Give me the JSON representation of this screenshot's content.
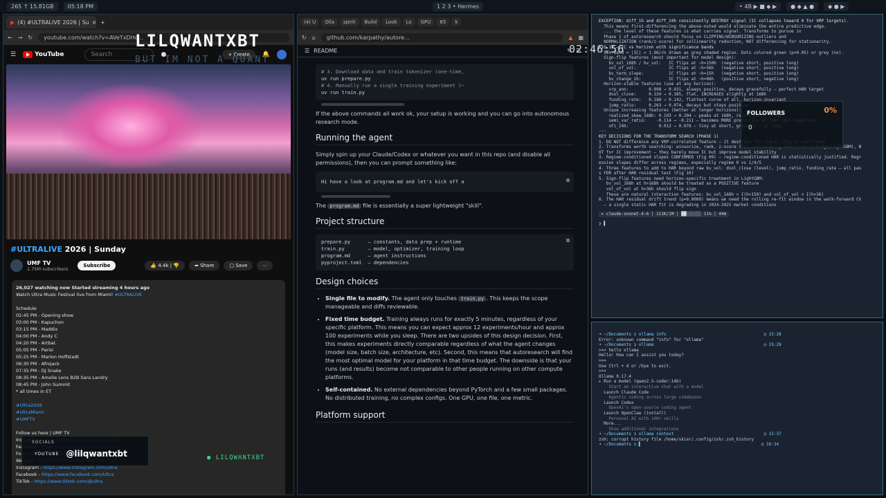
{
  "topbar": {
    "chip1": "265  ↑ 15.81GB",
    "chip2": "05:18 PM",
    "workspaces": "1  2  3  • Hermes",
    "right1": "• 4B ▶ ■ ◆ ▶",
    "right2": "● ◆ ▲ ●",
    "right3": "◆ ● ▶"
  },
  "youtube": {
    "tab_label": "(4) #ULTRALIVE 2026 | Su",
    "url": "youtube.com/watch?v=AVeTxDHo...",
    "logo": "YouTube",
    "search_placeholder": "Search",
    "create_label": "+ Create",
    "video_title_tag": "#ULTRALIVE",
    "video_title_rest": " 2026 | Sunday",
    "channel": "UMF TV",
    "subscribers": "1.75M subscribers",
    "subscribe_label": "Subscribe",
    "likes": "4.4k",
    "share_label": "Share",
    "save_label": "Save",
    "desc_stats": "26,027 watching now  Started streaming 4 hours ago",
    "desc_line": "Watch Ultra Music Festival live from Miami!",
    "desc_tag": "#ULTRALIVE",
    "schedule_header": "Schedule",
    "schedule": [
      "02:45 PM - Opening show",
      "03:00 PM - Kapuchon",
      "03:15 PM - Maddix",
      "04:00 PM - Andy C",
      "04:20 PM - Artbat",
      "05:05 PM - Parisi",
      "05:25 PM - Marlon Hoffstadt",
      "06:30 PM - Afrojack",
      "07:35 PM - DJ Snake",
      "08:35 PM - Amelie Lens B2B Sara Landry",
      "08:45 PM - John Summit",
      "* all times in ET"
    ],
    "hashtags": [
      "#Ultra2026",
      "#UltraMiami",
      "#UMFTV"
    ],
    "follow_header": "Follow us here | UMF TV",
    "links": [
      {
        "label": "Instagram - ",
        "url": "https://www.instagram.com/umftv"
      },
      {
        "label": "Facebook - ",
        "url": "https://www.facebook.com/umftv"
      },
      {
        "label": "Follow us here | Ultra Music Festival",
        "url": ""
      },
      {
        "label": "Website - ",
        "url": "https://ultramusicfestival.com"
      },
      {
        "label": "Instagram - ",
        "url": "https://www.instagram.com/ultra"
      },
      {
        "label": "Facebook - ",
        "url": "https://www.facebook.com/Ultra"
      },
      {
        "label": "TikTok - ",
        "url": "https://www.tiktok.com/@ultra"
      }
    ]
  },
  "overlay": {
    "name": "LILQWANTXBT",
    "sub": "BUT IM NOT A QUANT",
    "socials_header": "SOCIALS",
    "socials_platform": "YOUTUBE",
    "socials_handle": "@lilqwantxbt",
    "green_tag": "● LILQWANTXBT",
    "timer": "02:46:56",
    "followers_label": "FOLLOWERS",
    "followers_pct": "0%",
    "followers_count": "0"
  },
  "github": {
    "tabs": [
      "(4) U",
      "Olla",
      "spirit",
      "Build",
      "Look",
      "Lo",
      "GPU",
      "65",
      "k"
    ],
    "url": "github.com/karpathy/autore...",
    "readme_label": "README",
    "code1": [
      "# 3. Download data and train tokenizer (one-time,",
      "uv run prepare.py",
      "",
      "# 4. Manually run a single training experiment (~",
      "uv run train.py"
    ],
    "p1": "If the above commands all work ok, your setup is working and you can go into autonomous research mode.",
    "h_running": "Running the agent",
    "p2": "Simply spin up your Claude/Codex or whatever you want in this repo (and disable all permissions), then you can prompt something like:",
    "code2": "Hi have a look at program.md and let's kick off a",
    "p3_code": "program.md",
    "p3_rest": " file is essentially a super lightweight \"skill\".",
    "p3_pre": "The ",
    "h_structure": "Project structure",
    "code3": [
      "prepare.py      — constants, data prep + runtime",
      "train.py        — model, optimizer, training loop",
      "program.md      — agent instructions",
      "pyproject.toml  — dependencies"
    ],
    "h_design": "Design choices",
    "b1_title": "Single file to modify.",
    "b1_text": " The agent only touches ",
    "b1_code": "train.py",
    "b1_text2": ". This keeps the scope manageable and diffs reviewable.",
    "b2_title": "Fixed time budget.",
    "b2_text": " Training always runs for exactly 5 minutes, regardless of your specific platform. This means you can expect approx 12 experiments/hour and approx 100 experiments while you sleep. There are two upsides of this design decision. First, this makes experiments directly comparable regardless of what the agent changes (model size, batch size, architecture, etc). Second, this means that autoresearch will find the most optimal model for your platform in that time budget. The downside is that your runs (and results) become not comparable to other people running on other compute platforms.",
    "b3_title": "Self-contained.",
    "b3_text": " No external dependencies beyond PyTorch and a few small packages. No distributed training, no complex configs. One GPU, one file, one metric.",
    "h_platform": "Platform support"
  },
  "terminal1": {
    "lines": [
      "EXCEPTION: diff_1h and diff_24h consistently DESTROY signal (IC collapses toward 0 for VRP targets).",
      "  This means first-differencing the above-noted would eliminate the entire predictive edge.",
      "",
      "  ... the level of these features is what carries signal. Transforms to pursue in",
      "  Phase 1 of autoresearch should focus on CLIPPING/WINSORIZING outliers and",
      "  NORMALIZATION (rank/z-score) for collinearity reduction, NOT differencing for stationarity.",
      "",
      "FIG 12 — IC vs horizon with significance bands",
      "  95% band = |IC| > 1.96/√n drawn as grey shaded region. Dots colored green (p<0.05) or grey (ns).",
      "",
      "  Sign-flip features (most important for model design):",
      "    bv_vol_168h / bv_vol:   IC flips at ~h=150h  (negative short, positive long)",
      "    vol_of_vol:             IC flips at ~h=36h   (negative short, positive long)",
      "    bv_term_slope:          IC flips at ~h=15h   (negative short, positive long)",
      "    bv_change_1h:           IC flips at ~h=96h   (positive short, negative long)",
      "",
      "  Horizon-stable features (use at any horizon):",
      "    vrp_ann:        0.998 → 0.431, always positive, decays gracefully — perfect HAR target",
      "    dvol_close:     0.334 → 0.385, flat, INCREASES slightly at 168h",
      "    funding_rate:   0.188 → 0.142, flattest curve of all, horizon-invariant",
      "    jump_ratio:     0.263 → 0.074, decays but stays positive",
      "",
      "  Unique increasing features (better at longer horizons):",
      "    realized_skew_168h: 0.103 → 0.204 — peaks at 168h, rarely picks it up",
      "    semi_var_ratio:    -0.114 → -0.211 — becomes MORE predictive at 168h (but negative)",
      "    ofi_24h:            0.012 → 0.078 — tiny at short, grows to ~ at long",
      "",
      "---",
      "",
      "KEY DECISIONS FOR THE TRANSFORM SEARCH (PHASE 1)",
      "",
      "1. DO NOT difference any VRP-correlated feature — it destroys the signal (Fig 11 confirmed)",
      "",
      "2. Transforms worth searching: winsorize, rank, z-score (for collinearity reduction in Ridge/LightGBM), N",
      "OT for IC improvement — they barely move IC but improve model stability",
      "",
      "3. Regime-conditioned slopes CONFIRMED (Fig 09) — regime-conditioned HAR is statistically justified. Regr",
      "ession slopes differ across regimes, especially regime 0 vs 1/4/5",
      "",
      "4. Three features to add to HAR beyond raw bv_vol: dvol_close (level), jump_ratio, funding_rate — all pas",
      "s FDR after HAR residual test (Fig 10)",
      "",
      "5. Sign-flip features need horizon-specific treatment in LightGBM:",
      "   bv_vol_168h at h>168h should be treated as a POSITIVE feature",
      "   vol_of_vol at h>36h should flip sign",
      "   These are natural interaction features: bv_vol_168h × I(h>150) and vol_of_vol × I(h>36)",
      "",
      "6. The HAR residual drift trend (p=0.0000) means we need the rolling re-fit window in the walk-forward CV",
      "  — a single static HAR fit is degrading in 2024-2025 market conditions"
    ],
    "status": " ▸ claude-sonnet-4-6 │ 111K/1M │ ██░░░░░░ 11% │ 44m ",
    "prompt": "❯ ▌"
  },
  "terminal2": {
    "lines": [
      "➜ ~/Documents ❯ ollama info                                       ◷ 15:28",
      "Error: unknown command \"info\" for \"ollama\"",
      "➜ ~/Documents ❯ ollama                                            ◷ 15:28",
      ">>> hello ollama",
      "Hello! How can I assist you today?",
      "",
      ">>>",
      "Use Ctrl + d or /bye to exit.",
      ">>>",
      "Ollama 0.17.4",
      "",
      "▸ Run a model (qwen2.5-coder:14b)",
      "    Start an interactive chat with a model",
      "",
      "  Launch Claude Code",
      "    Agentic coding across large codebases",
      "",
      "  Launch Codex",
      "    OpenAI's open-source coding agent",
      "",
      "  Launch OpenClaw (install)",
      "    Personal AI with 100+ skills",
      "",
      "  More...",
      "    Show additional integrations",
      "",
      "",
      "",
      "",
      "",
      "➜ ~/Documents ❯ ollama context                                    ◷ 15:37",
      "zsh: corrupt history file /home/skiar/.config/zsh/.zsh_history",
      "➜ ~/Documents ❯ ▌                                                ◷ 16:34"
    ]
  }
}
